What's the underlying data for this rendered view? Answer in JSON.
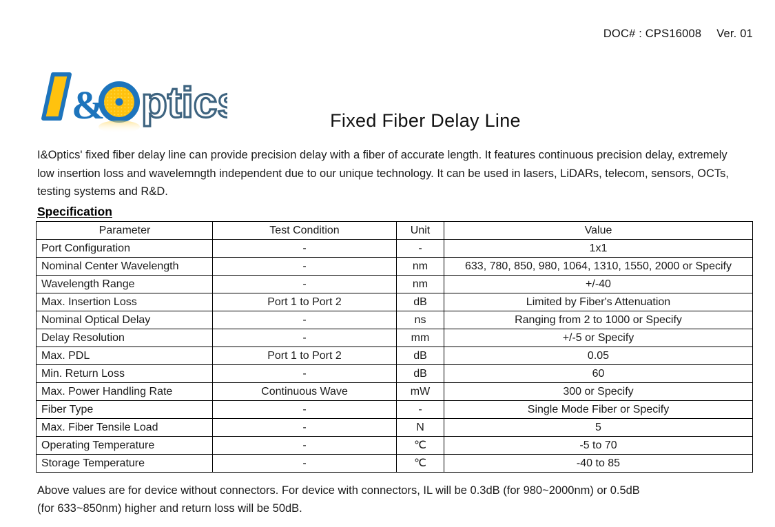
{
  "header": {
    "doc_label": "DOC# : CPS16008",
    "version": "Ver. 01"
  },
  "logo": {
    "brand_text": "I&Optics",
    "letter_i": "I",
    "ampersand": "&",
    "letter_o": "O",
    "word_tail": "ptics",
    "colors": {
      "yellow": "#FFC20E",
      "blue": "#1D74BC",
      "outline": "#3E6480"
    }
  },
  "title": "Fixed Fiber Delay Line",
  "intro": "I&Optics' fixed fiber delay line can provide precision delay with a fiber of accurate length. It features continuous precision delay, extremely low insertion loss and wavelemngth independent due to our unique technology. It can be used in lasers, LiDARs, telecom, sensors, OCTs, testing systems and R&D.",
  "specification": {
    "heading": "Specification",
    "columns": [
      "Parameter",
      "Test Condition",
      "Unit",
      "Value"
    ],
    "rows": [
      {
        "parameter": "Port Configuration",
        "test_condition": "-",
        "unit": "-",
        "value": "1x1"
      },
      {
        "parameter": "Nominal Center Wavelength",
        "test_condition": "-",
        "unit": "nm",
        "value": "633, 780, 850, 980, 1064, 1310, 1550, 2000 or Specify"
      },
      {
        "parameter": "Wavelength Range",
        "test_condition": "-",
        "unit": "nm",
        "value": "+/-40"
      },
      {
        "parameter": "Max. Insertion Loss",
        "test_condition": "Port 1 to Port 2",
        "unit": "dB",
        "value": "Limited by Fiber's Attenuation"
      },
      {
        "parameter": "Nominal Optical Delay",
        "test_condition": "-",
        "unit": "ns",
        "value": "Ranging from 2 to 1000 or Specify"
      },
      {
        "parameter": "Delay Resolution",
        "test_condition": "-",
        "unit": "mm",
        "value": "+/-5 or Specify"
      },
      {
        "parameter": "Max. PDL",
        "test_condition": "Port 1 to Port 2",
        "unit": "dB",
        "value": "0.05"
      },
      {
        "parameter": "Min. Return Loss",
        "test_condition": "-",
        "unit": "dB",
        "value": "60"
      },
      {
        "parameter": "Max. Power Handling Rate",
        "test_condition": "Continuous Wave",
        "unit": "mW",
        "value": "300 or Specify"
      },
      {
        "parameter": "Fiber Type",
        "test_condition": "-",
        "unit": "-",
        "value": "Single Mode Fiber or Specify"
      },
      {
        "parameter": "Max. Fiber Tensile Load",
        "test_condition": "-",
        "unit": "N",
        "value": "5"
      },
      {
        "parameter": "Operating Temperature",
        "test_condition": "-",
        "unit": "℃",
        "value": "-5 to 70"
      },
      {
        "parameter": "Storage Temperature",
        "test_condition": "-",
        "unit": "℃",
        "value": "-40 to 85"
      }
    ]
  },
  "footnote": {
    "line1": "Above values are for device without connectors. For device with connectors, IL will be 0.3dB (for 980~2000nm) or 0.5dB",
    "line2": "(for 633~850nm) higher and return loss will be 50dB."
  }
}
